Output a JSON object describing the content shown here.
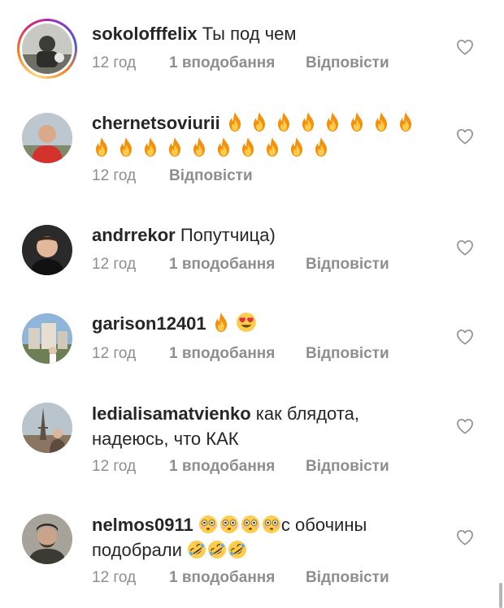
{
  "comments": [
    {
      "username": "sokolofffelix",
      "text": "Ты под чем",
      "time": "12 год",
      "likes": "1 вподобання",
      "reply": "Відповісти",
      "has_story": true
    },
    {
      "username": "chernetsoviurii",
      "text": "",
      "emojis": [
        "fire-emoji",
        "fire-emoji",
        "fire-emoji",
        "fire-emoji",
        "fire-emoji",
        "fire-emoji",
        "fire-emoji",
        "fire-emoji",
        "fire-emoji",
        "fire-emoji",
        "fire-emoji",
        "fire-emoji",
        "fire-emoji",
        "fire-emoji",
        "fire-emoji",
        "fire-emoji",
        "fire-emoji",
        "fire-emoji"
      ],
      "time": "12 год",
      "reply": "Відповісти"
    },
    {
      "username": "andrrekor",
      "text": "Попутчица)",
      "time": "12 год",
      "likes": "1 вподобання",
      "reply": "Відповісти"
    },
    {
      "username": "garison12401",
      "text": "",
      "emojis": [
        "fire-emoji",
        "heart-eyes-emoji"
      ],
      "time": "12 год",
      "likes": "1 вподобання",
      "reply": "Відповісти"
    },
    {
      "username": "ledialisamatvienko",
      "text_line1": "как блядота,",
      "text_line2": "надеюсь, что КАК",
      "time": "12 год",
      "likes": "1 вподобання",
      "reply": "Відповісти"
    },
    {
      "username": "nelmos0911",
      "emojis_before": [
        "flushed-emoji",
        "flushed-emoji",
        "flushed-emoji",
        "flushed-emoji"
      ],
      "text_line1": "с обочины",
      "text_line2": "подобрали",
      "emojis_after": [
        "rofl-emoji",
        "rofl-emoji",
        "rofl-emoji"
      ],
      "time": "12 год",
      "likes": "1 вподобання",
      "reply": "Відповісти"
    }
  ],
  "colors": {
    "text": "#262626",
    "meta": "#8e8e8e",
    "background": "#ffffff"
  }
}
